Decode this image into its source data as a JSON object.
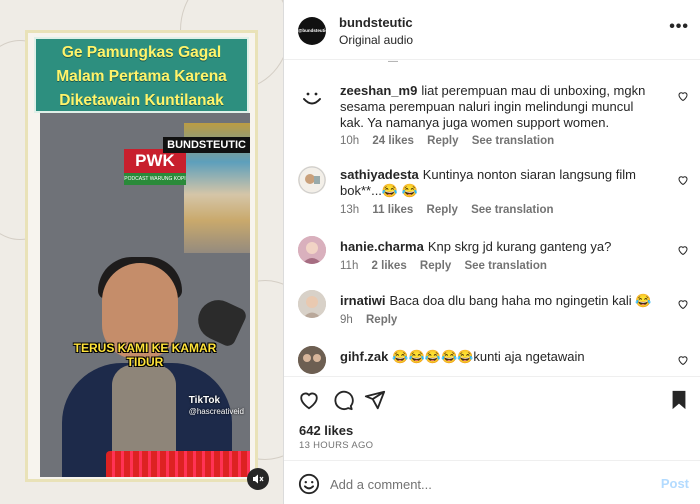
{
  "video": {
    "title_line1": "Ge Pamungkas Gagal",
    "title_line2": "Malam Pertama Karena",
    "title_line3": "Diketawain Kuntilanak",
    "logo": "PWK",
    "logo_sub": "PODCAST WARUNG KOPI",
    "brand_tag": "BUNDSTEUTIC",
    "caption_line1": "TERUS KAMI KE KAMAR",
    "caption_line2": "TIDUR",
    "tiktok_label": "TikTok",
    "tiktok_handle": "@hascreativeid",
    "mute_icon": "speaker-muted-icon"
  },
  "header": {
    "avatar_text": "@bundsteutic",
    "username": "bundsteutic",
    "audio": "Original audio"
  },
  "comments": [
    {
      "user": "zeeshan_m9",
      "text": "liat perempuan mau di unboxing, mgkn sesama perempuan naluri ingin melindungi muncul kak. Ya namanya juga women support women.",
      "time": "10h",
      "likes": "24 likes",
      "reply": "Reply",
      "translate": "See translation"
    },
    {
      "user": "sathiyadesta",
      "text": "Kuntinya nonton siaran langsung film bok**...😂 😂",
      "time": "13h",
      "likes": "11 likes",
      "reply": "Reply",
      "translate": "See translation"
    },
    {
      "user": "hanie.charma",
      "text": "Knp skrg jd kurang ganteng ya?",
      "time": "11h",
      "likes": "2 likes",
      "reply": "Reply",
      "translate": "See translation"
    },
    {
      "user": "irnatiwi",
      "text": "Baca doa dlu bang haha mo ngingetin kali 😂",
      "time": "9h",
      "reply": "Reply"
    },
    {
      "user": "gihf.zak",
      "text": "😂😂😂😂😂kunti aja ngetawain"
    }
  ],
  "post": {
    "likes": "642 likes",
    "time": "13 HOURS AGO"
  },
  "composer": {
    "placeholder": "Add a comment...",
    "post_label": "Post"
  }
}
